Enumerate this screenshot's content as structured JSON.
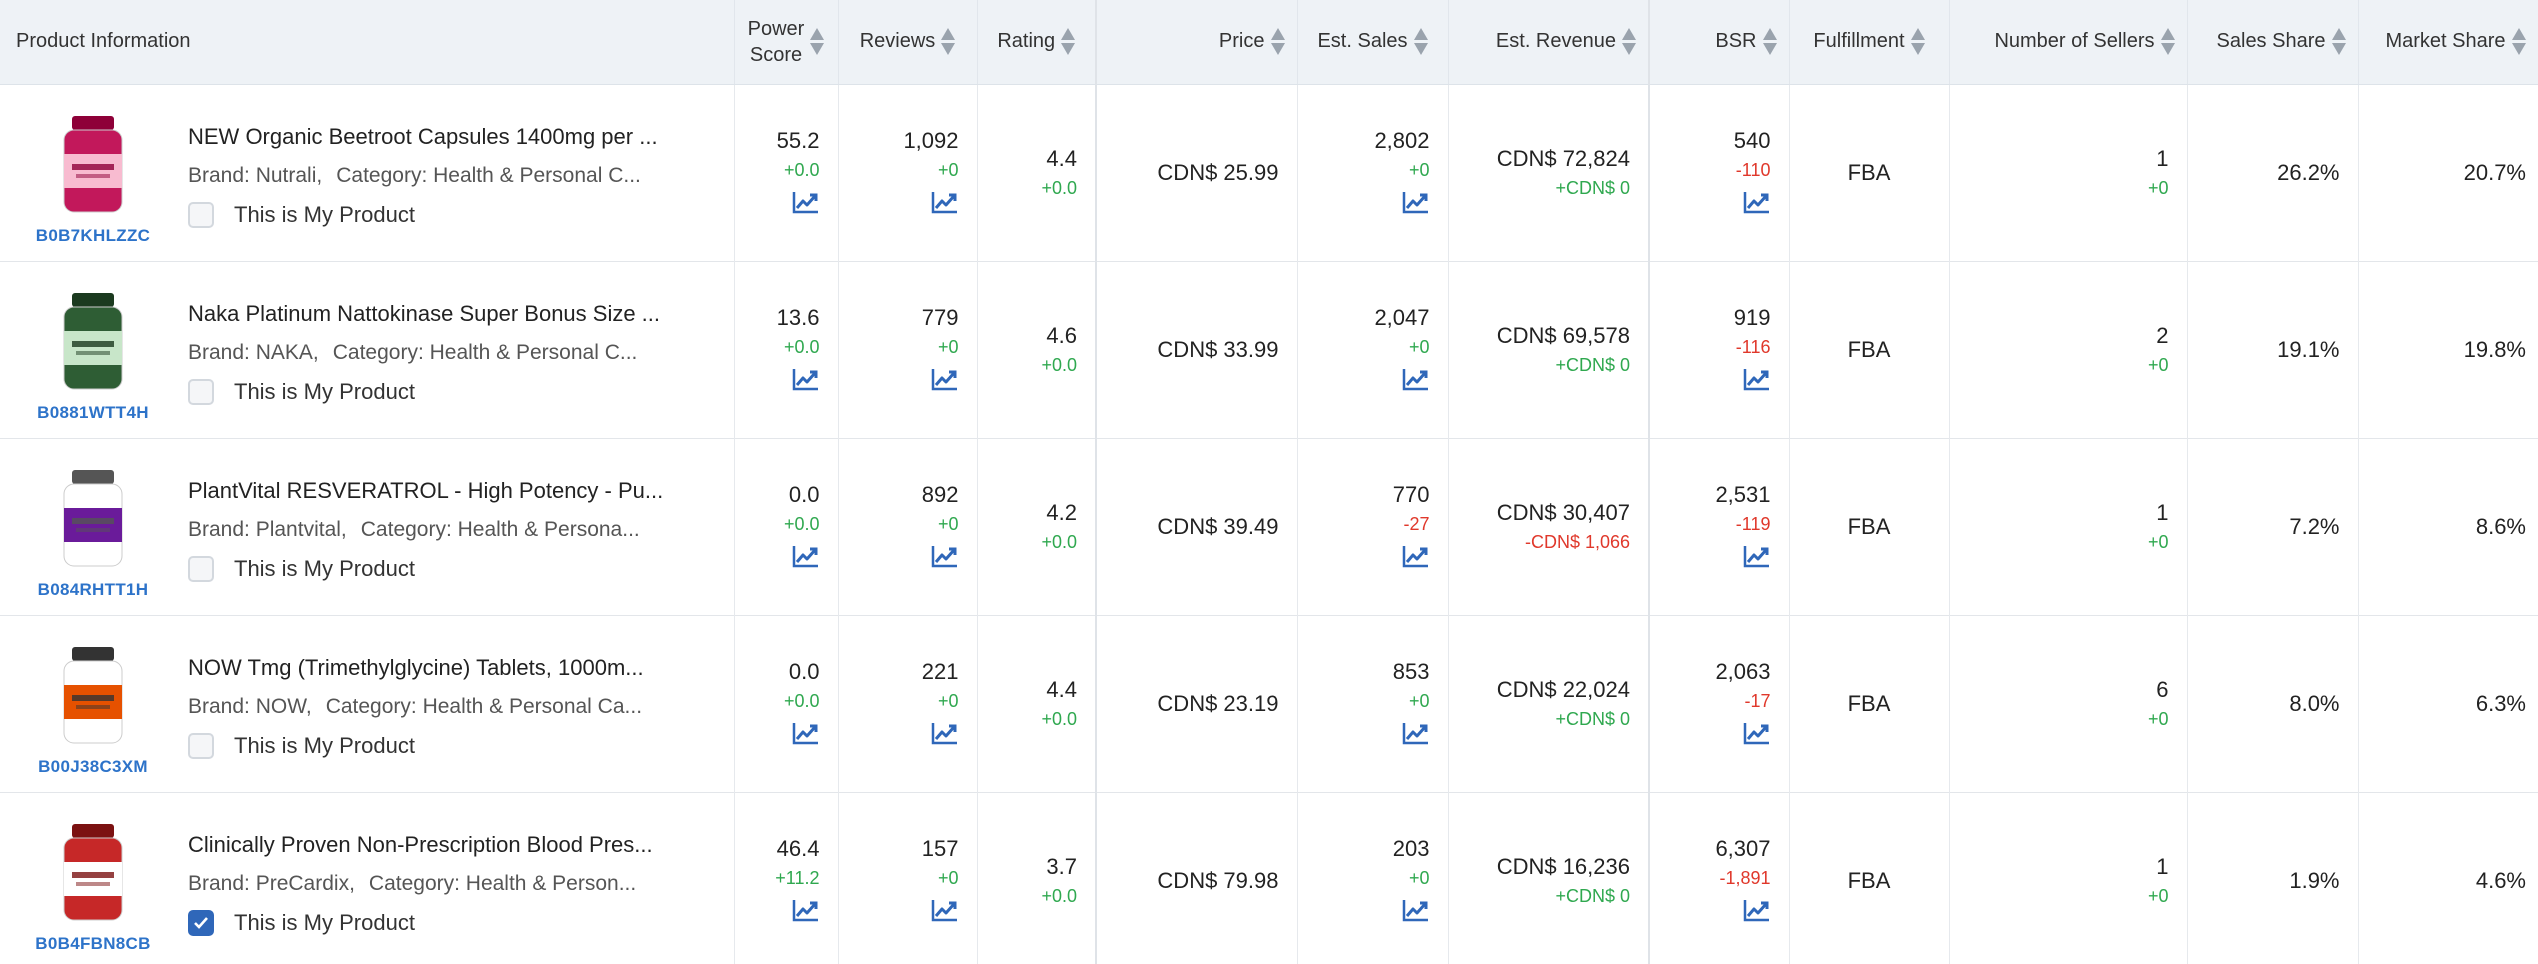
{
  "columns": {
    "product": "Product Information",
    "power_score_1": "Power",
    "power_score_2": "Score",
    "reviews": "Reviews",
    "rating": "Rating",
    "price": "Price",
    "est_sales": "Est. Sales",
    "est_revenue": "Est. Revenue",
    "bsr": "BSR",
    "fulfillment": "Fulfillment",
    "num_sellers": "Number of Sellers",
    "sales_share": "Sales Share",
    "market_share": "Market Share"
  },
  "rows": [
    {
      "asin": "B0B7KHLZZC",
      "title": "NEW Organic Beetroot Capsules 1400mg per ...",
      "brand": "Brand: Nutrali,",
      "category": "Category: Health & Personal C...",
      "my_product_label": "This is My Product",
      "my_product_checked": false,
      "power_score": "55.2",
      "power_score_delta": "+0.0",
      "reviews": "1,092",
      "reviews_delta": "+0",
      "rating": "4.4",
      "rating_delta": "+0.0",
      "price": "CDN$ 25.99",
      "est_sales": "2,802",
      "est_sales_delta": "+0",
      "est_revenue": "CDN$ 72,824",
      "est_revenue_delta": "+CDN$ 0",
      "bsr": "540",
      "bsr_delta": "-110",
      "fulfillment": "FBA",
      "num_sellers": "1",
      "num_sellers_delta": "+0",
      "sales_share": "26.2%",
      "market_share": "20.7%"
    },
    {
      "asin": "B0881WTT4H",
      "title": "Naka Platinum Nattokinase Super Bonus Size ...",
      "brand": "Brand: NAKA,",
      "category": "Category: Health & Personal C...",
      "my_product_label": "This is My Product",
      "my_product_checked": false,
      "power_score": "13.6",
      "power_score_delta": "+0.0",
      "reviews": "779",
      "reviews_delta": "+0",
      "rating": "4.6",
      "rating_delta": "+0.0",
      "price": "CDN$ 33.99",
      "est_sales": "2,047",
      "est_sales_delta": "+0",
      "est_revenue": "CDN$ 69,578",
      "est_revenue_delta": "+CDN$ 0",
      "bsr": "919",
      "bsr_delta": "-116",
      "fulfillment": "FBA",
      "num_sellers": "2",
      "num_sellers_delta": "+0",
      "sales_share": "19.1%",
      "market_share": "19.8%"
    },
    {
      "asin": "B084RHTT1H",
      "title": "PlantVital RESVERATROL - High Potency - Pu...",
      "brand": "Brand: Plantvital,",
      "category": "Category: Health & Persona...",
      "my_product_label": "This is My Product",
      "my_product_checked": false,
      "power_score": "0.0",
      "power_score_delta": "+0.0",
      "reviews": "892",
      "reviews_delta": "+0",
      "rating": "4.2",
      "rating_delta": "+0.0",
      "price": "CDN$ 39.49",
      "est_sales": "770",
      "est_sales_delta": "-27",
      "est_revenue": "CDN$ 30,407",
      "est_revenue_delta": "-CDN$ 1,066",
      "bsr": "2,531",
      "bsr_delta": "-119",
      "fulfillment": "FBA",
      "num_sellers": "1",
      "num_sellers_delta": "+0",
      "sales_share": "7.2%",
      "market_share": "8.6%"
    },
    {
      "asin": "B00J38C3XM",
      "title": "NOW Tmg (Trimethylglycine) Tablets, 1000m...",
      "brand": "Brand: NOW,",
      "category": "Category: Health & Personal Ca...",
      "my_product_label": "This is My Product",
      "my_product_checked": false,
      "power_score": "0.0",
      "power_score_delta": "+0.0",
      "reviews": "221",
      "reviews_delta": "+0",
      "rating": "4.4",
      "rating_delta": "+0.0",
      "price": "CDN$ 23.19",
      "est_sales": "853",
      "est_sales_delta": "+0",
      "est_revenue": "CDN$ 22,024",
      "est_revenue_delta": "+CDN$ 0",
      "bsr": "2,063",
      "bsr_delta": "-17",
      "fulfillment": "FBA",
      "num_sellers": "6",
      "num_sellers_delta": "+0",
      "sales_share": "8.0%",
      "market_share": "6.3%"
    },
    {
      "asin": "B0B4FBN8CB",
      "title": "Clinically Proven Non-Prescription Blood Pres...",
      "brand": "Brand: PreCardix,",
      "category": "Category: Health & Person...",
      "my_product_label": "This is My Product",
      "my_product_checked": true,
      "power_score": "46.4",
      "power_score_delta": "+11.2",
      "reviews": "157",
      "reviews_delta": "+0",
      "rating": "3.7",
      "rating_delta": "+0.0",
      "price": "CDN$ 79.98",
      "est_sales": "203",
      "est_sales_delta": "+0",
      "est_revenue": "CDN$ 16,236",
      "est_revenue_delta": "+CDN$ 0",
      "bsr": "6,307",
      "bsr_delta": "-1,891",
      "fulfillment": "FBA",
      "num_sellers": "1",
      "num_sellers_delta": "+0",
      "sales_share": "1.9%",
      "market_share": "4.6%"
    }
  ],
  "colors": {
    "positive": "#2fa84f",
    "negative": "#e0382b",
    "asin_link": "#2d73c9",
    "trend_icon": "#2f67b9",
    "header_bg": "#eef2f6"
  },
  "icons": {
    "sort": "sort-arrows-icon",
    "trend": "trend-chart-icon",
    "checkbox": "checkbox-icon"
  }
}
